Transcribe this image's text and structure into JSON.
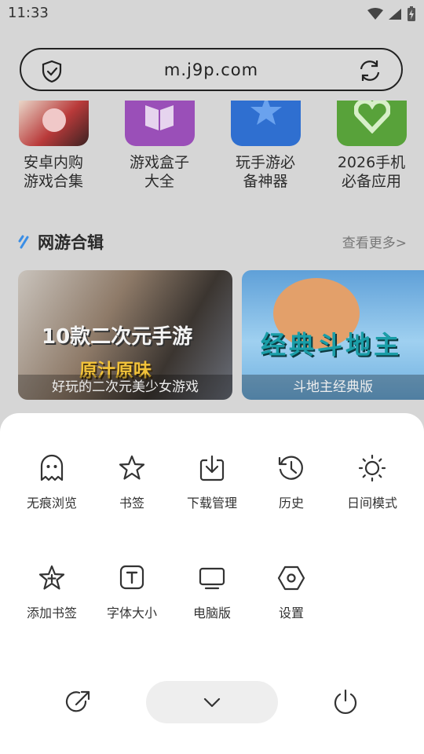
{
  "status": {
    "time": "11:33"
  },
  "url_bar": {
    "url": "m.j9p.com"
  },
  "apps": [
    {
      "label_line1": "安卓内购",
      "label_line2": "游戏合集",
      "tile_color": "#b93a3a"
    },
    {
      "label_line1": "游戏盒子",
      "label_line2": "大全",
      "tile_color": "#8e44ad"
    },
    {
      "label_line1": "玩手游必",
      "label_line2": "备神器",
      "tile_color": "#2f6fd0"
    },
    {
      "label_line1": "2026手机",
      "label_line2": "必备应用",
      "tile_color": "#58a23a"
    }
  ],
  "section": {
    "title": "网游合辑",
    "more": "查看更多>"
  },
  "cards": [
    {
      "overlay_line1": "10款二次元手游",
      "overlay_line2": "原汁原味",
      "caption": "好玩的二次元美少女游戏"
    },
    {
      "overlay_line1": "经典斗地主",
      "caption": "斗地主经典版"
    }
  ],
  "menu": {
    "row1": [
      {
        "label": "无痕浏览",
        "icon": "ghost-icon"
      },
      {
        "label": "书签",
        "icon": "star-icon"
      },
      {
        "label": "下载管理",
        "icon": "download-icon"
      },
      {
        "label": "历史",
        "icon": "history-icon"
      },
      {
        "label": "日间模式",
        "icon": "sun-icon"
      }
    ],
    "row2": [
      {
        "label": "添加书签",
        "icon": "star-plus-icon"
      },
      {
        "label": "字体大小",
        "icon": "font-size-icon"
      },
      {
        "label": "电脑版",
        "icon": "monitor-icon"
      },
      {
        "label": "设置",
        "icon": "settings-icon"
      }
    ]
  },
  "bottom_actions": [
    "share-icon",
    "chevron-down-icon",
    "power-icon"
  ]
}
